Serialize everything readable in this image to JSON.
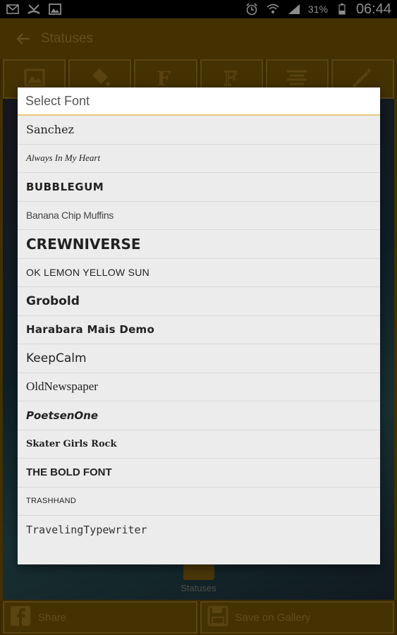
{
  "status_bar": {
    "time": "06:44",
    "battery": "31%",
    "icons": [
      "mail-icon",
      "missed-call-icon",
      "gallery-icon",
      "alarm-icon",
      "wifi-icon",
      "signal-icon",
      "battery-icon"
    ]
  },
  "app_bar": {
    "title": "Statuses"
  },
  "toolbar": {
    "buttons": [
      "background-icon",
      "paint-bucket-icon",
      "font-style-icon",
      "font-icon",
      "align-icon",
      "magic-wand-icon"
    ]
  },
  "poster": {
    "label": "Statuses"
  },
  "bottom_bar": {
    "share_label": "Share",
    "save_label": "Save on Gallery"
  },
  "dialog": {
    "title": "Select Font",
    "fonts": [
      "Sanchez",
      "Always In My Heart",
      "BUBBLEGUM",
      "Banana Chip Muffins",
      "CREWNIVERSE",
      "OK LEMON YELLOW SUN",
      "Grobold",
      "Harabara Mais Demo",
      "KeepCalm",
      "OldNewspaper",
      "PoetsenOne",
      "Skater Girls Rock",
      "THE BOLD FONT",
      "TRASHHAND",
      "TravelingTypewriter"
    ]
  },
  "colors": {
    "accent": "#7c5a05",
    "dialog_bg": "#ececec",
    "divider": "#e8c77a"
  }
}
